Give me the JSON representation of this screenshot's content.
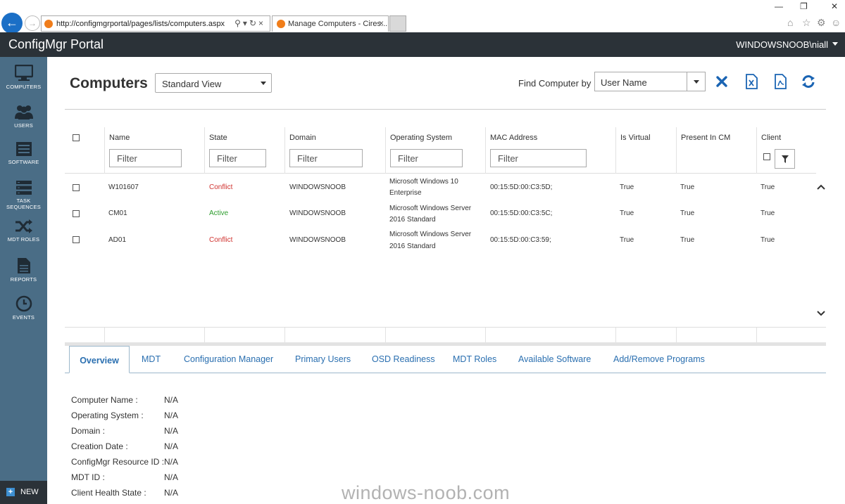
{
  "browser": {
    "url": "http://configmgrportal/pages/lists/computers.aspx",
    "tab_title": "Manage Computers - Cires...",
    "tab_close": "×"
  },
  "app": {
    "title": "ConfigMgr Portal",
    "user": "WINDOWSNOOB\\niall"
  },
  "sidebar": {
    "items": [
      {
        "label": "COMPUTERS",
        "icon": "monitor-icon"
      },
      {
        "label": "USERS",
        "icon": "users-icon"
      },
      {
        "label": "SOFTWARE",
        "icon": "software-icon"
      },
      {
        "label": "TASK",
        "label2": "SEQUENCES",
        "icon": "task-sequence-icon"
      },
      {
        "label": "MDT ROLES",
        "icon": "shuffle-icon"
      },
      {
        "label": "REPORTS",
        "icon": "report-icon"
      },
      {
        "label": "EVENTS",
        "icon": "clock-icon"
      }
    ],
    "new_label": "NEW"
  },
  "toolbar": {
    "page_title": "Computers",
    "view_value": "Standard View",
    "find_label": "Find Computer by",
    "find_value": "User Name"
  },
  "grid": {
    "columns": [
      "Name",
      "State",
      "Domain",
      "Operating System",
      "MAC Address",
      "Is Virtual",
      "Present In CM",
      "Client"
    ],
    "filter_placeholder": "Filter",
    "rows": [
      {
        "name": "W101607",
        "state": "Conflict",
        "domain": "WINDOWSNOOB",
        "os1": "Microsoft Windows 10",
        "os2": "Enterprise",
        "mac": "00:15:5D:00:C3:5D;",
        "virtual": "True",
        "present": "True",
        "client": "True"
      },
      {
        "name": "CM01",
        "state": "Active",
        "domain": "WINDOWSNOOB",
        "os1": "Microsoft Windows Server",
        "os2": "2016 Standard",
        "mac": "00:15:5D:00:C3:5C;",
        "virtual": "True",
        "present": "True",
        "client": "True"
      },
      {
        "name": "AD01",
        "state": "Conflict",
        "domain": "WINDOWSNOOB",
        "os1": "Microsoft Windows Server",
        "os2": "2016 Standard",
        "mac": "00:15:5D:00:C3:59;",
        "virtual": "True",
        "present": "True",
        "client": "True"
      }
    ]
  },
  "tabs": [
    "Overview",
    "MDT",
    "Configuration Manager",
    "Primary Users",
    "OSD Readiness",
    "MDT Roles",
    "Available Software",
    "Add/Remove Programs"
  ],
  "details": [
    {
      "label": "Computer Name :",
      "value": "N/A"
    },
    {
      "label": "Operating System :",
      "value": "N/A"
    },
    {
      "label": "Domain :",
      "value": "N/A"
    },
    {
      "label": "Creation Date :",
      "value": "N/A"
    },
    {
      "label": "ConfigMgr Resource ID :",
      "value": "N/A"
    },
    {
      "label": "MDT ID :",
      "value": "N/A"
    },
    {
      "label": "Client Health State :",
      "value": "N/A"
    }
  ],
  "watermark": "windows-noob.com",
  "colors": {
    "sidebar": "#4a6d86",
    "header": "#2b3238",
    "accent": "#2a6fb0",
    "conflict": "#d0322f",
    "active": "#2f9d2f"
  }
}
